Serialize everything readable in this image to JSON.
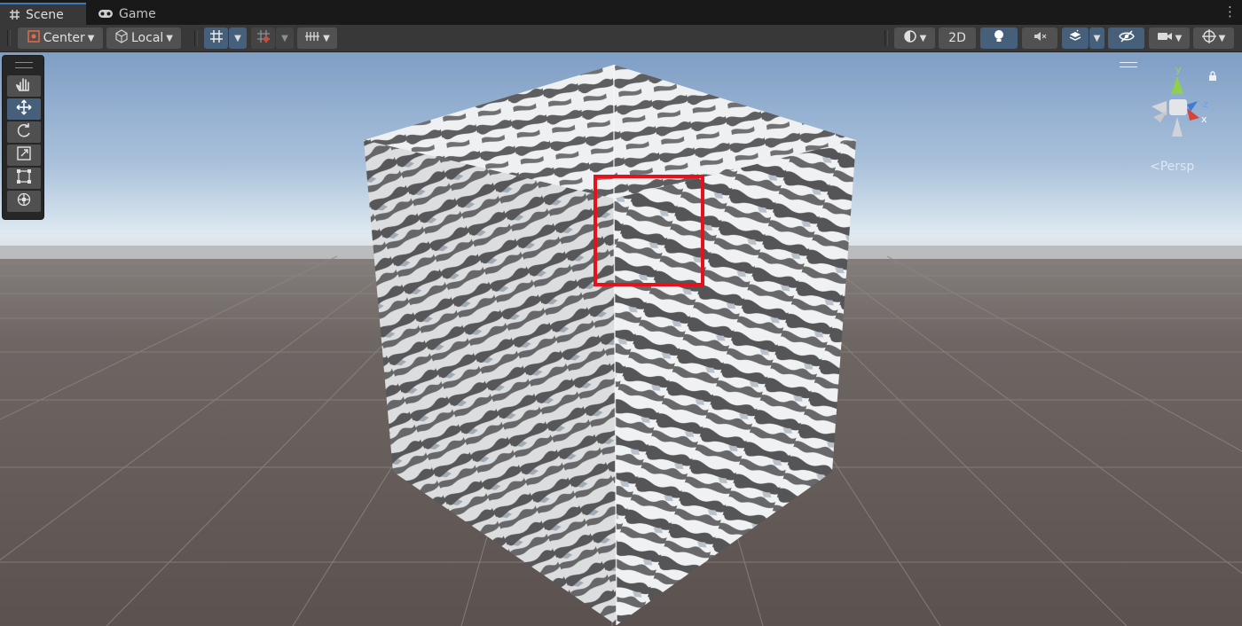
{
  "tabs": [
    {
      "label": "Scene",
      "icon": "grid-icon",
      "active": true
    },
    {
      "label": "Game",
      "icon": "gamepad-icon",
      "active": false
    }
  ],
  "toolbar": {
    "pivot_mode": "Center",
    "pivot_rotation": "Local",
    "mode_2d": "2D"
  },
  "scene": {
    "projection_label": "Persp",
    "gizmo_axes": {
      "x": "x",
      "y": "y",
      "z": "z"
    }
  },
  "colors": {
    "accent": "#3a79bb",
    "highlight_box": "#e8101a",
    "toggle_on": "#46607c"
  }
}
